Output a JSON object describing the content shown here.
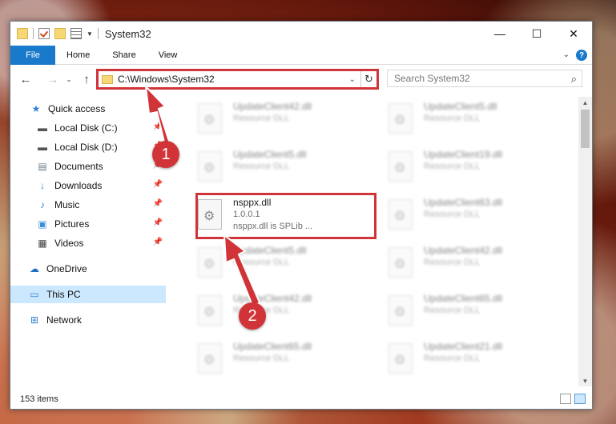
{
  "window": {
    "title": "System32"
  },
  "window_controls": {
    "minimize": "—",
    "maximize": "☐",
    "close": "✕"
  },
  "ribbon": {
    "tabs": [
      "File",
      "Home",
      "Share",
      "View"
    ]
  },
  "address": {
    "path": "C:\\Windows\\System32"
  },
  "search": {
    "placeholder": "Search System32"
  },
  "sidebar": {
    "items": [
      {
        "label": "Quick access",
        "icon": "star-icon",
        "pinned": false
      },
      {
        "label": "Local Disk (C:)",
        "icon": "drive-icon",
        "pinned": true
      },
      {
        "label": "Local Disk (D:)",
        "icon": "drive-icon",
        "pinned": true
      },
      {
        "label": "Documents",
        "icon": "documents-icon",
        "pinned": true
      },
      {
        "label": "Downloads",
        "icon": "download-icon",
        "pinned": true
      },
      {
        "label": "Music",
        "icon": "music-icon",
        "pinned": true
      },
      {
        "label": "Pictures",
        "icon": "pictures-icon",
        "pinned": true
      },
      {
        "label": "Videos",
        "icon": "videos-icon",
        "pinned": true
      },
      {
        "label": "OneDrive",
        "icon": "cloud-icon",
        "pinned": false
      },
      {
        "label": "This PC",
        "icon": "computer-icon",
        "pinned": false
      },
      {
        "label": "Network",
        "icon": "network-icon",
        "pinned": false
      }
    ]
  },
  "files": [
    {
      "name": "UpdateClient42.dll",
      "sub1": "Resource DLL",
      "sub2": "",
      "blurred": true
    },
    {
      "name": "UpdateClient5.dll",
      "sub1": "Resource DLL",
      "sub2": "",
      "blurred": true
    },
    {
      "name": "UpdateClient5.dll",
      "sub1": "Resource DLL",
      "sub2": "",
      "blurred": true
    },
    {
      "name": "UpdateClient19.dll",
      "sub1": "Resource DLL",
      "sub2": "",
      "blurred": true
    },
    {
      "name": "nsppx.dll",
      "sub1": "1.0.0.1",
      "sub2": "nsppx.dll is SPLib ...",
      "blurred": false
    },
    {
      "name": "UpdateClient63.dll",
      "sub1": "Resource DLL",
      "sub2": "",
      "blurred": true
    },
    {
      "name": "UpdateClient5.dll",
      "sub1": "Resource DLL",
      "sub2": "",
      "blurred": true
    },
    {
      "name": "UpdateClient42.dll",
      "sub1": "Resource DLL",
      "sub2": "",
      "blurred": true
    },
    {
      "name": "UpdateClient42.dll",
      "sub1": "Resource DLL",
      "sub2": "",
      "blurred": true
    },
    {
      "name": "UpdateClient65.dll",
      "sub1": "Resource DLL",
      "sub2": "",
      "blurred": true
    },
    {
      "name": "UpdateClient65.dll",
      "sub1": "Resource DLL",
      "sub2": "",
      "blurred": true
    },
    {
      "name": "UpdateClient21.dll",
      "sub1": "Resource DLL",
      "sub2": "",
      "blurred": true
    }
  ],
  "status": {
    "count": "153 items"
  },
  "markers": {
    "one": "1",
    "two": "2"
  },
  "colors": {
    "accent": "#1979ca",
    "highlight": "#d13438",
    "selection": "#cce8ff"
  }
}
